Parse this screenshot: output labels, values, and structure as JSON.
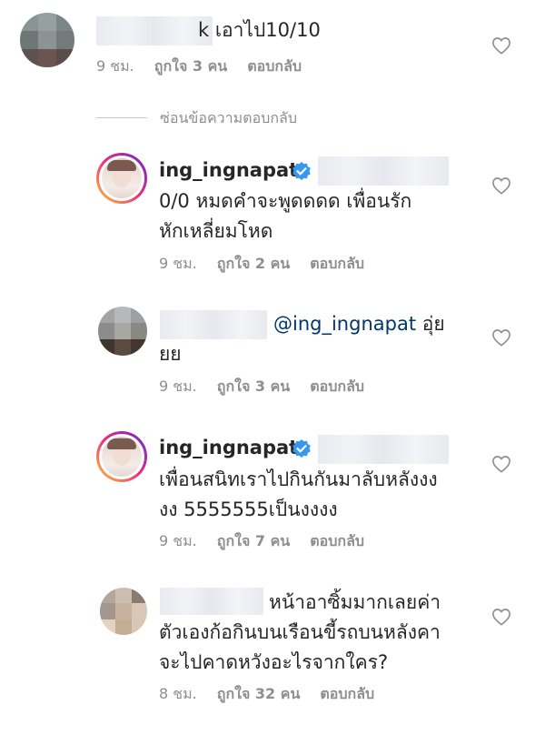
{
  "comments": [
    {
      "text_suffix": "k เอาไป10/10",
      "time": "9 ชม.",
      "likes": "ถูกใจ 3 คน",
      "reply": "ตอบกลับ"
    },
    {
      "username": "ing_ingnapat",
      "text_line1": "0/0 หมดคำจะพูดดดด เพื่อนรัก",
      "text_line2": "หักเหลี่ยมโหด",
      "time": "9 ชม.",
      "likes": "ถูกใจ 2 คน",
      "reply": "ตอบกลับ"
    },
    {
      "mention": "@ing_ingnapat",
      "text_after": "อุ่ย",
      "text_line2": "ยย",
      "time": "9 ชม.",
      "likes": "ถูกใจ 3 คน",
      "reply": "ตอบกลับ"
    },
    {
      "username": "ing_ingnapat",
      "text_line1": "เพื่อนสนิทเราไปกินกันมาลับหลังงง",
      "text_line2": "งง 5555555เป็นงงงง",
      "time": "9 ชม.",
      "likes": "ถูกใจ 7 คน",
      "reply": "ตอบกลับ"
    },
    {
      "text_line1": "หน้าอาซิ้มมากเลยค่า",
      "text_line2": "ตัวเองก้อกินบนเรือนขี้รถบนหลังคา",
      "text_line3": "จะไปคาดหวังอะไรจากใคร?",
      "time": "8 ชม.",
      "likes": "ถูกใจ 32 คน",
      "reply": "ตอบกลับ"
    }
  ],
  "hide_replies_label": "ซ่อนข้อความตอบกลับ",
  "icons": {
    "like": "heart-outline-icon",
    "verified": "verified-badge-icon"
  },
  "colors": {
    "text": "#262626",
    "meta": "#8e8e8e",
    "verified": "#3897f0",
    "mention": "#00376b"
  }
}
